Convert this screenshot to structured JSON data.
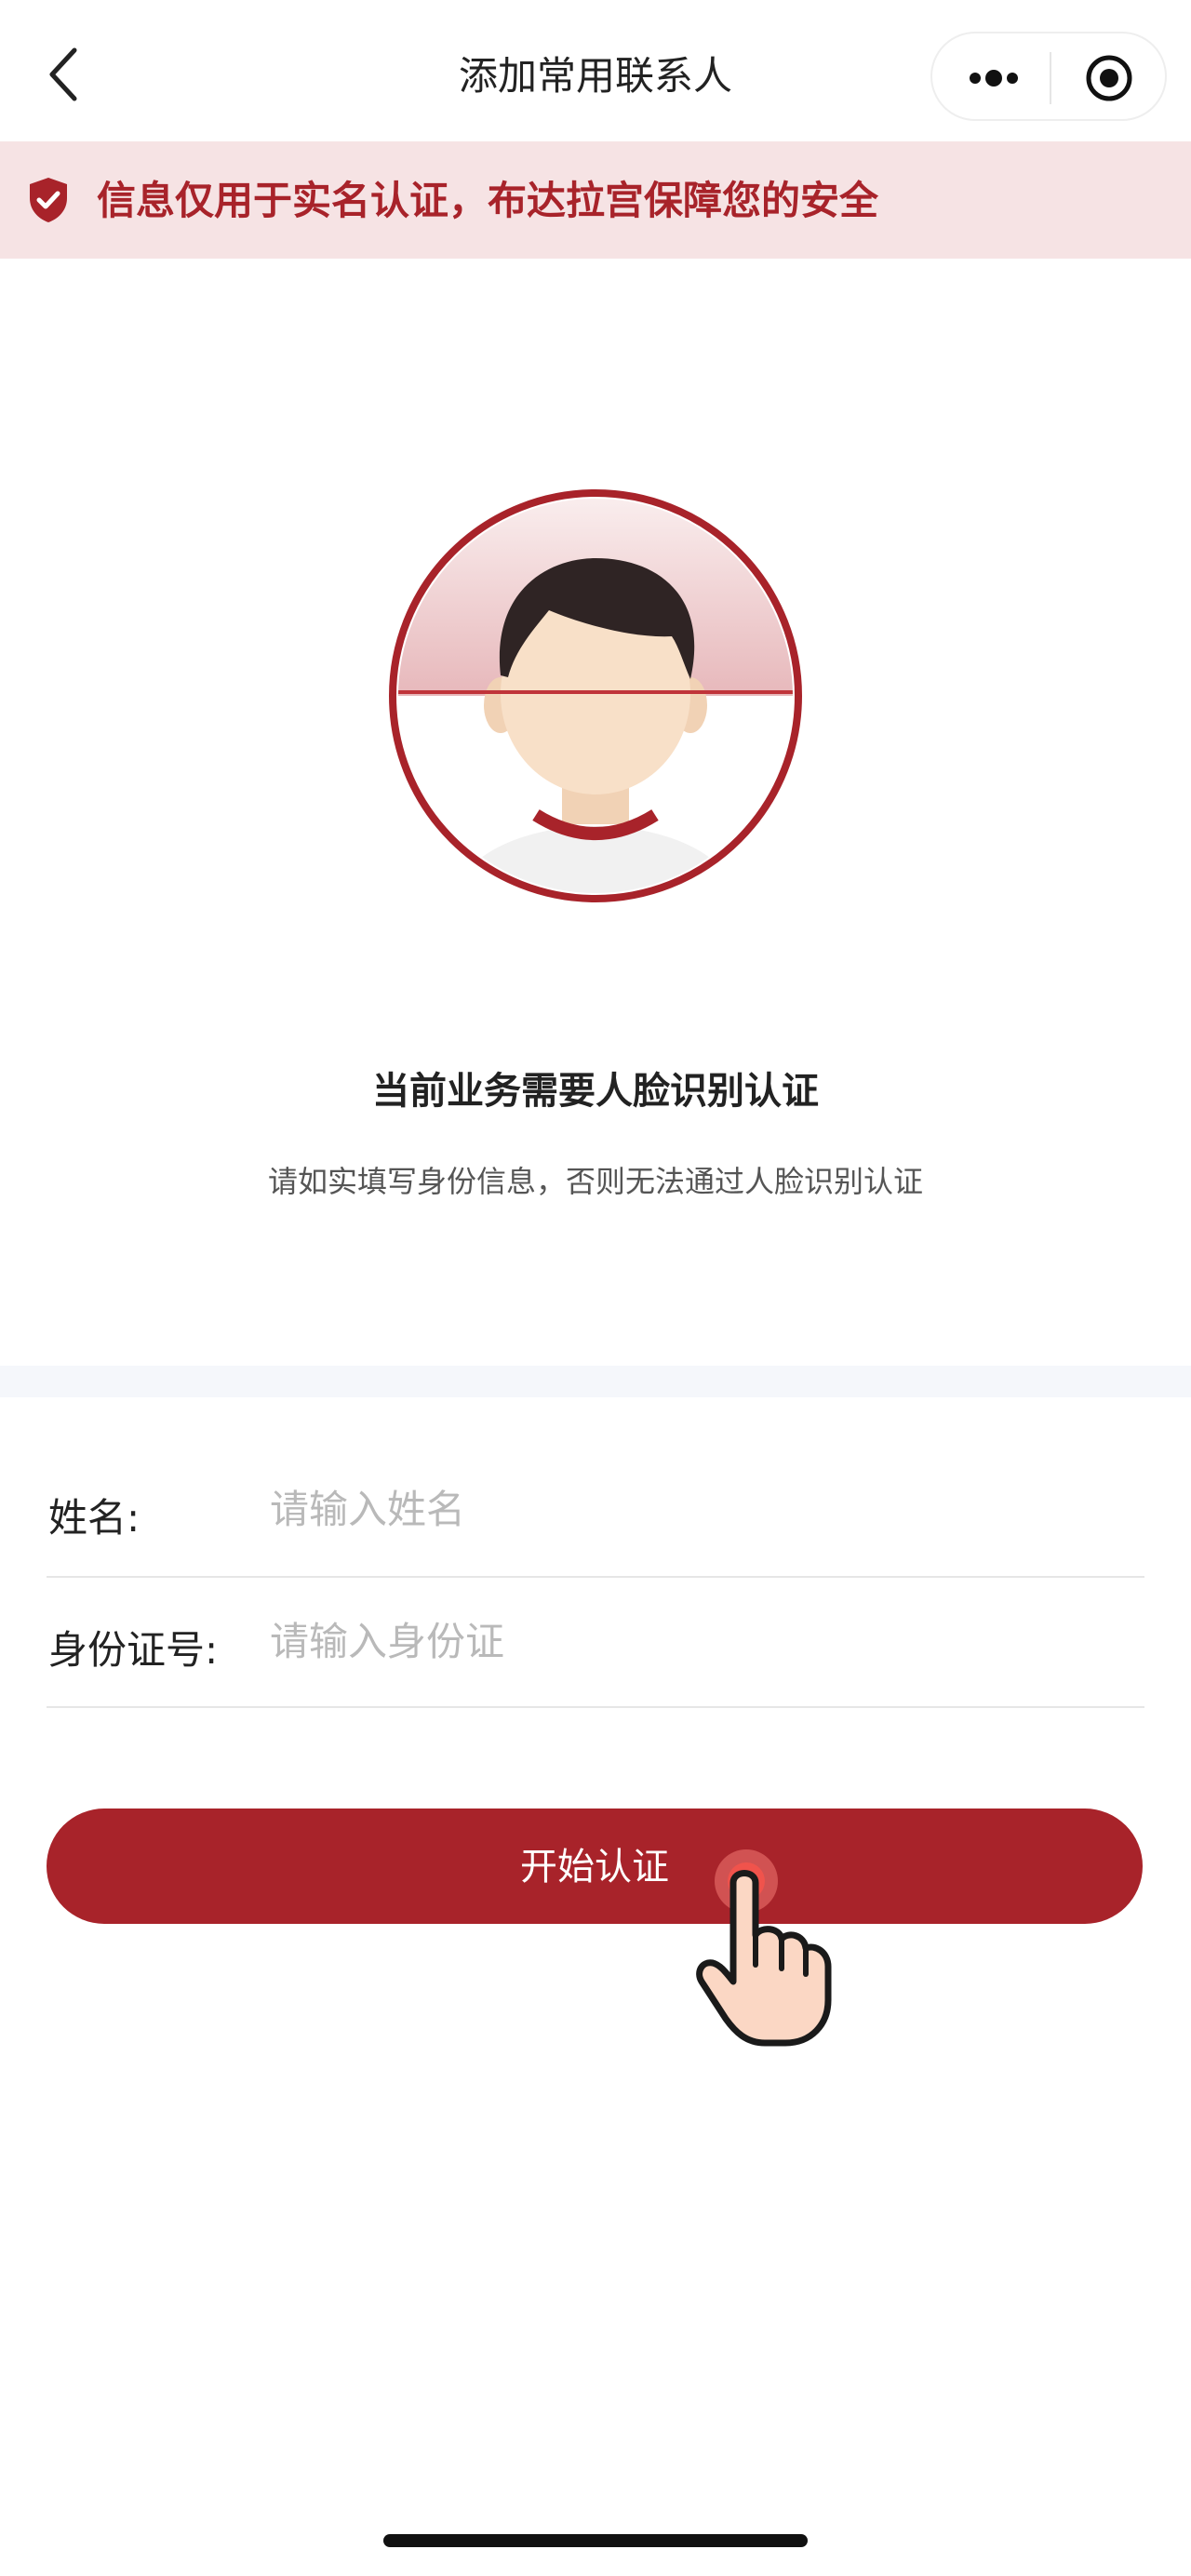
{
  "header": {
    "title": "添加常用联系人"
  },
  "banner": {
    "text": "信息仅用于实名认证，布达拉宫保障您的安全"
  },
  "face": {
    "main_title": "当前业务需要人脸识别认证",
    "sub_text": "请如实填写身份信息，否则无法通过人脸识别认证"
  },
  "form": {
    "name_label": "姓名:",
    "name_placeholder": "请输入姓名",
    "id_label": "身份证号:",
    "id_placeholder": "请输入身份证"
  },
  "submit": {
    "label": "开始认证"
  },
  "colors": {
    "accent": "#a8232a",
    "banner_bg": "#f6e3e4",
    "placeholder": "#b9b9b9"
  }
}
